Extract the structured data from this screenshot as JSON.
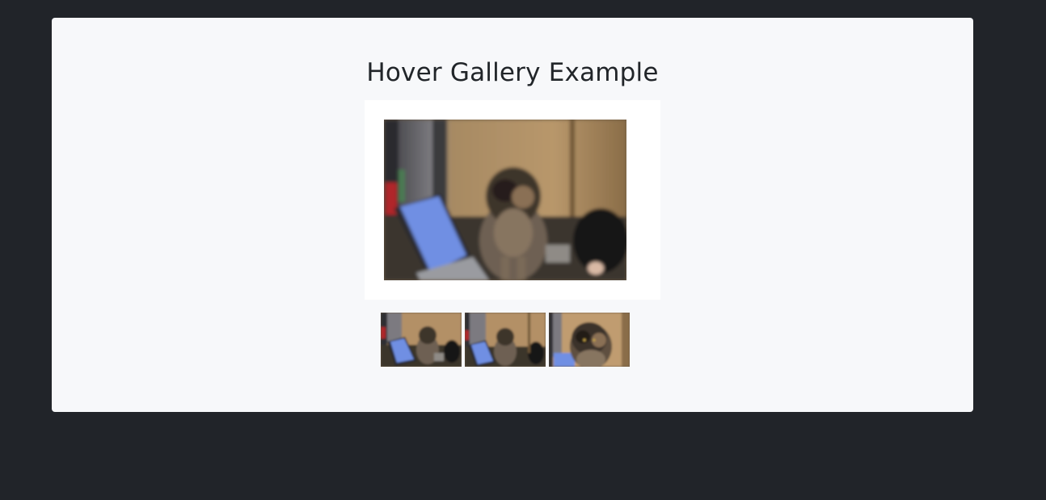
{
  "page": {
    "title": "Hover Gallery Example"
  },
  "gallery": {
    "main_image": {
      "subject": "cat",
      "selected_index": 0
    },
    "thumbnails": [
      {
        "subject": "cat"
      },
      {
        "subject": "cat"
      },
      {
        "subject": "cat"
      }
    ]
  },
  "colors": {
    "background": "#212429",
    "card": "#f7f8fa",
    "title_text": "#212529",
    "frame": "#ffffff"
  }
}
